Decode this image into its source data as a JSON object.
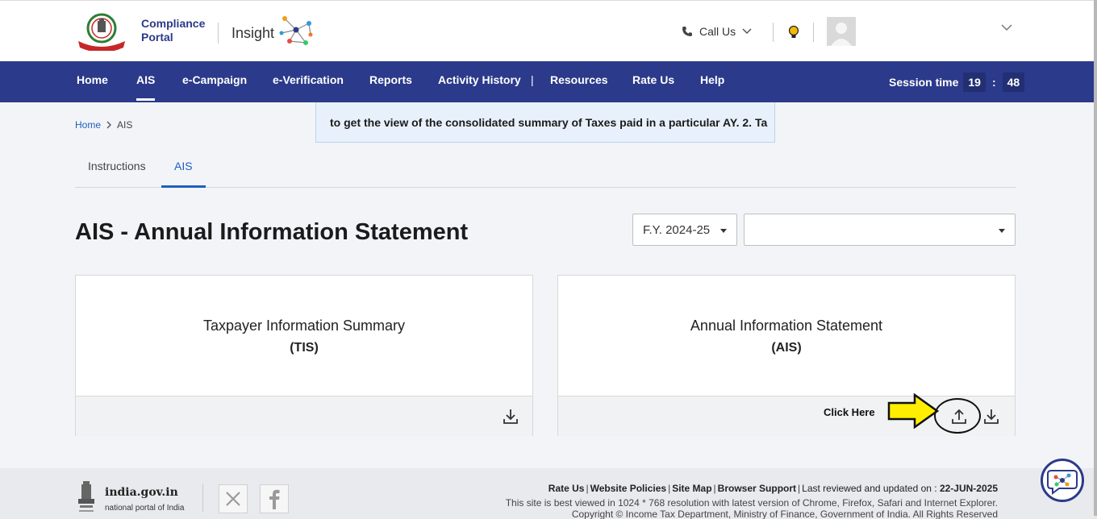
{
  "header": {
    "portal_line1": "Compliance",
    "portal_line2": "Portal",
    "insight_label": "Insight",
    "call_us": "Call Us",
    "user_name": ""
  },
  "nav": {
    "items": [
      {
        "label": "Home"
      },
      {
        "label": "AIS",
        "active": true
      },
      {
        "label": "e-Campaign"
      },
      {
        "label": "e-Verification"
      },
      {
        "label": "Reports"
      },
      {
        "label": "Activity History"
      },
      {
        "label": "Resources"
      },
      {
        "label": "Rate Us"
      },
      {
        "label": "Help"
      }
    ],
    "separator": "|",
    "session_label": "Session time",
    "session_minutes": "19",
    "session_colon": ":",
    "session_seconds": "48"
  },
  "breadcrumb": {
    "home": "Home",
    "current": "AIS"
  },
  "ticker_text": "to get the view of the consolidated summary of Taxes paid in a particular AY.   2. Ta",
  "tabs": [
    {
      "label": "Instructions"
    },
    {
      "label": "AIS",
      "active": true
    }
  ],
  "page_title": "AIS - Annual Information Statement",
  "filters": {
    "fy_value": "F.Y. 2024-25",
    "second_value": ""
  },
  "cards": [
    {
      "title": "Taxpayer Information Summary",
      "subtitle": "(TIS)"
    },
    {
      "title": "Annual Information Statement",
      "subtitle": "(AIS)",
      "annotation": "Click Here"
    }
  ],
  "footer": {
    "site_name": "india.gov.in",
    "site_tagline": "national portal of India",
    "links": [
      "Rate Us",
      "Website Policies",
      "Site Map",
      "Browser Support"
    ],
    "last_reviewed_label": "Last reviewed and updated on :",
    "last_reviewed_date": "22-JUN-2025",
    "best_viewed": "This site is best viewed in 1024 * 768 resolution with latest version of Chrome, Firefox, Safari and Internet Explorer.",
    "copyright": "Copyright © Income Tax Department, Ministry of Finance, Government of India. All Rights Reserved"
  },
  "colors": {
    "nav_bg": "#2b3a8a",
    "link_blue": "#1f5fbf",
    "annotation_yellow": "#ffee00"
  },
  "icons": [
    "emblem-icon",
    "insight-network-icon",
    "phone-icon",
    "chevron-down-icon",
    "bulb-icon",
    "download-icon",
    "upload-icon",
    "arrow-annotation-icon",
    "x-twitter-icon",
    "facebook-icon",
    "chatbot-icon"
  ]
}
